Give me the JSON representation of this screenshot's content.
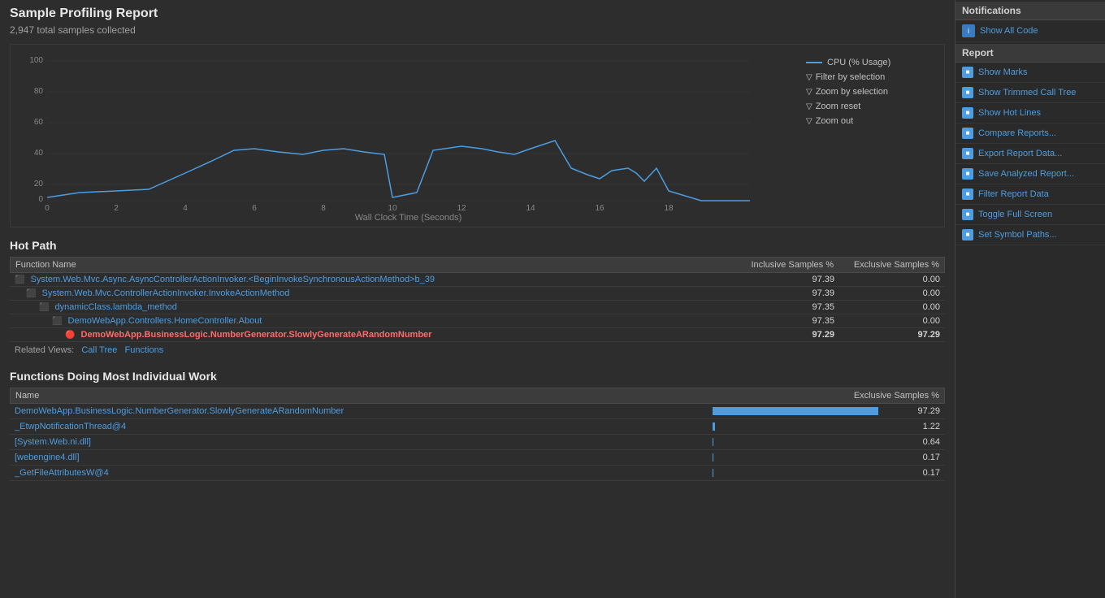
{
  "header": {
    "title": "Sample Profiling Report",
    "subtitle": "2,947 total samples collected"
  },
  "chart": {
    "cpu_label": "CPU (% Usage)",
    "x_axis_label": "Wall Clock Time (Seconds)",
    "y_ticks": [
      0,
      20,
      40,
      60,
      80,
      100
    ],
    "x_ticks": [
      0,
      2,
      4,
      6,
      8,
      10,
      12,
      14,
      16,
      18
    ],
    "legend": {
      "cpu_line": "CPU (% Usage)",
      "filter_by_selection": "Filter by selection",
      "zoom_by_selection": "Zoom by selection",
      "zoom_reset": "Zoom reset",
      "zoom_out": "Zoom out"
    }
  },
  "hot_path": {
    "section_title": "Hot Path",
    "col_function_name": "Function Name",
    "col_inclusive": "Inclusive Samples %",
    "col_exclusive": "Exclusive Samples %",
    "rows": [
      {
        "indent": 0,
        "name": "System.Web.Mvc.Async.AsyncControllerActionInvoker.<BeginInvokeSynchronousActionMethod>b_39",
        "inclusive": "97.39",
        "exclusive": "0.00",
        "highlight": false
      },
      {
        "indent": 1,
        "name": "System.Web.Mvc.ControllerActionInvoker.InvokeActionMethod",
        "inclusive": "97.39",
        "exclusive": "0.00",
        "highlight": false
      },
      {
        "indent": 2,
        "name": "dynamicClass.lambda_method",
        "inclusive": "97.35",
        "exclusive": "0.00",
        "highlight": false
      },
      {
        "indent": 3,
        "name": "DemoWebApp.Controllers.HomeController.About",
        "inclusive": "97.35",
        "exclusive": "0.00",
        "highlight": false
      },
      {
        "indent": 4,
        "name": "DemoWebApp.BusinessLogic.NumberGenerator.SlowlyGenerateARandomNumber",
        "inclusive": "97.29",
        "exclusive": "97.29",
        "highlight": true
      }
    ],
    "related_views_label": "Related Views:",
    "related_views": [
      {
        "label": "Call Tree",
        "id": "call-tree"
      },
      {
        "label": "Functions",
        "id": "functions"
      }
    ]
  },
  "functions": {
    "section_title": "Functions Doing Most Individual Work",
    "col_name": "Name",
    "col_exclusive": "Exclusive Samples %",
    "rows": [
      {
        "name": "DemoWebApp.BusinessLogic.NumberGenerator.SlowlyGenerateARandomNumber",
        "exclusive": "97.29",
        "bar_pct": 97.29
      },
      {
        "name": "_EtwpNotificationThread@4",
        "exclusive": "1.22",
        "bar_pct": 1.22
      },
      {
        "name": "[System.Web.ni.dll]",
        "exclusive": "0.64",
        "bar_pct": 0.64
      },
      {
        "name": "[webengine4.dll]",
        "exclusive": "0.17",
        "bar_pct": 0.17
      },
      {
        "name": "_GetFileAttributesW@4",
        "exclusive": "0.17",
        "bar_pct": 0.17
      }
    ]
  },
  "sidebar": {
    "notifications_header": "Notifications",
    "report_header": "Report",
    "items_notifications": [
      {
        "label": "Show All Code",
        "icon": "info-icon",
        "id": "show-all-code"
      }
    ],
    "items_report": [
      {
        "label": "Show Marks",
        "icon": "chart-icon",
        "id": "show-marks"
      },
      {
        "label": "Show Trimmed Call Tree",
        "icon": "tree-icon",
        "id": "show-trimmed-call-tree"
      },
      {
        "label": "Show Hot Lines",
        "icon": "hot-icon",
        "id": "show-hot-lines"
      },
      {
        "label": "Compare Reports...",
        "icon": "compare-icon",
        "id": "compare-reports"
      },
      {
        "label": "Export Report Data...",
        "icon": "export-icon",
        "id": "export-report-data"
      },
      {
        "label": "Save Analyzed Report...",
        "icon": "save-icon",
        "id": "save-analyzed-report"
      },
      {
        "label": "Filter Report Data",
        "icon": "filter-icon",
        "id": "filter-report-data"
      },
      {
        "label": "Toggle Full Screen",
        "icon": "fullscreen-icon",
        "id": "toggle-full-screen"
      },
      {
        "label": "Set Symbol Paths...",
        "icon": "symbol-icon",
        "id": "set-symbol-paths"
      }
    ]
  }
}
